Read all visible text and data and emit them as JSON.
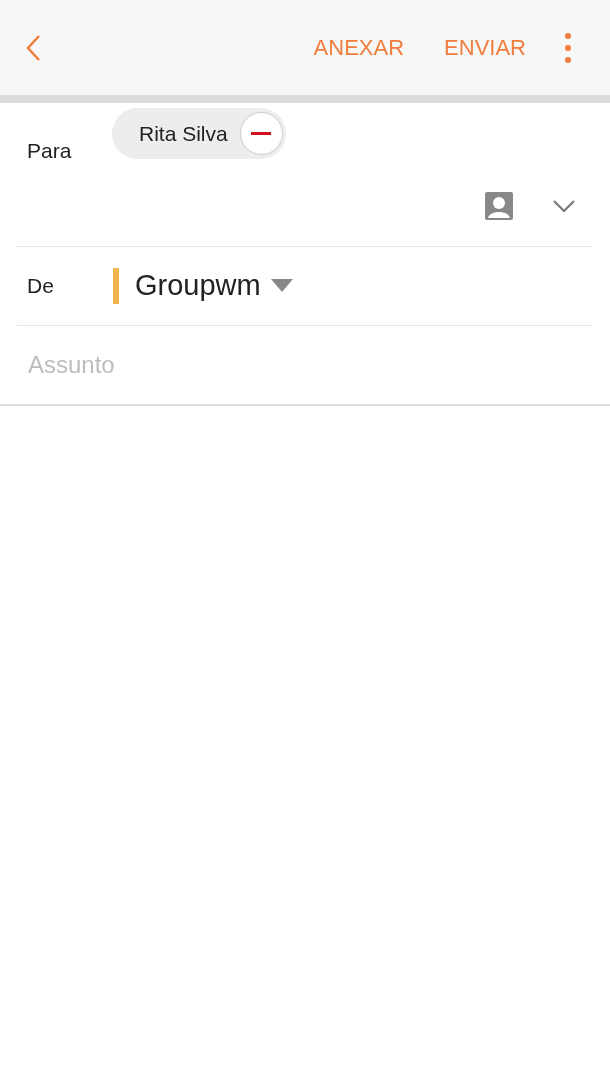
{
  "header": {
    "actions": [
      "ANEXAR",
      "ENVIAR"
    ]
  },
  "to": {
    "label": "Para",
    "recipients": [
      {
        "name": "Rita Silva"
      }
    ]
  },
  "from": {
    "label": "De",
    "account": "Groupwm",
    "color": "#f0b44c"
  },
  "subject": {
    "placeholder": "Assunto"
  }
}
